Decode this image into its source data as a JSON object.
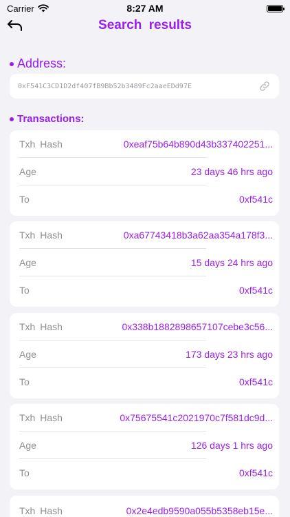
{
  "status_bar": {
    "carrier": "Carrier",
    "time": "8:27 AM"
  },
  "nav": {
    "title": "Search  results"
  },
  "address_section": {
    "label": "Address:",
    "value": "0xF541C3CD1D2df407fB9Bb52b3489Fc2aaeEDd97E"
  },
  "transactions_section": {
    "label": "Transactions:"
  },
  "labels": {
    "hash": "Txh  Hash",
    "age": "Age",
    "to": "To"
  },
  "transactions": [
    {
      "hash": "0xeaf75b64b890d43b337402251...",
      "age": "23 days 46 hrs ago",
      "to": "0xf541c"
    },
    {
      "hash": "0xa67743418b3a62aa354a178f3...",
      "age": "15 days 24 hrs ago",
      "to": "0xf541c"
    },
    {
      "hash": "0x338b1882898657107cebe3c56...",
      "age": "173 days 23 hrs ago",
      "to": "0xf541c"
    },
    {
      "hash": "0x75675541c2021970c7f581dc9d...",
      "age": "126 days 1 hrs ago",
      "to": "0xf541c"
    },
    {
      "hash": "0x2e4edb9590a055b5358eb15e..."
    }
  ],
  "colors": {
    "accent": "#9b1fe8",
    "background": "#f2f2f7",
    "label_gray": "#8e8e93"
  },
  "icons": {
    "back": "back-arrow-icon",
    "copy": "link-icon",
    "wifi": "wifi-icon",
    "battery": "battery-icon"
  }
}
